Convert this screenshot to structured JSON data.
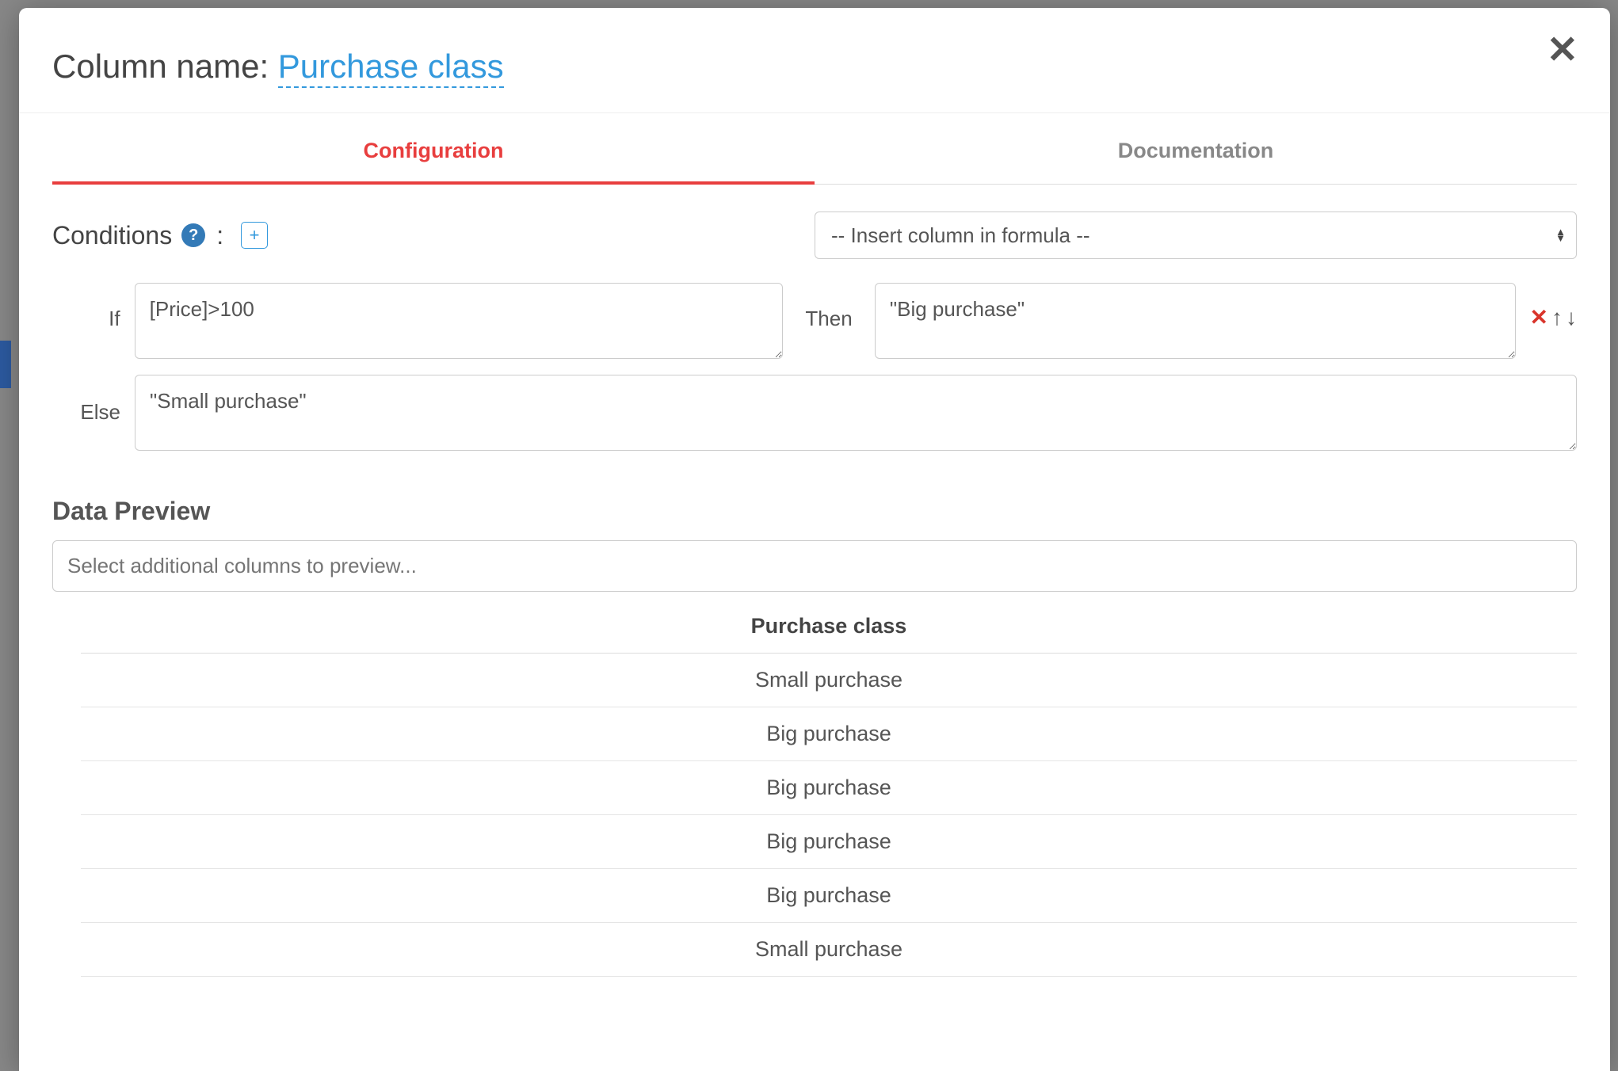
{
  "header": {
    "title_prefix": "Column name: ",
    "column_name": "Purchase class"
  },
  "tabs": {
    "configuration": "Configuration",
    "documentation": "Documentation"
  },
  "conditions": {
    "label": "Conditions",
    "colon": ":",
    "add_label": "+",
    "insert_placeholder": "-- Insert column in formula --"
  },
  "rule": {
    "if_label": "If",
    "if_value": "[Price]>100",
    "then_label": "Then",
    "then_value": "\"Big purchase\"",
    "else_label": "Else",
    "else_value": "\"Small purchase\""
  },
  "preview": {
    "heading": "Data Preview",
    "select_placeholder": "Select additional columns to preview...",
    "table": {
      "header": "Purchase class",
      "rows": [
        "Small purchase",
        "Big purchase",
        "Big purchase",
        "Big purchase",
        "Big purchase",
        "Small purchase"
      ]
    }
  }
}
